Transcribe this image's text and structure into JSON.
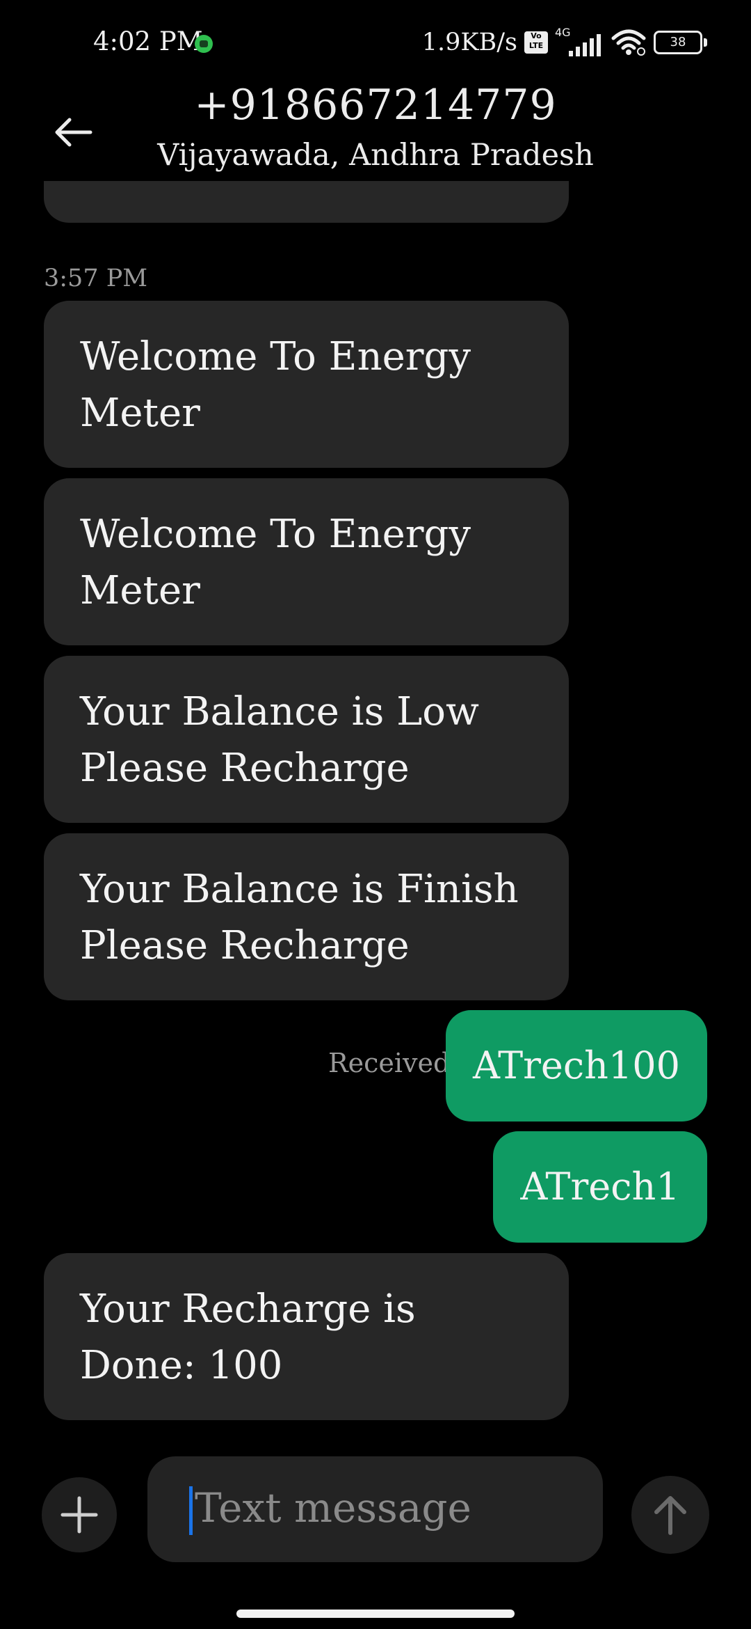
{
  "status_bar": {
    "time": "4:02 PM",
    "network_speed": "1.9KB/s",
    "volte_label": "Vo LTE",
    "network_type": "4G",
    "battery": "38",
    "icons": [
      "app-notification-icon",
      "volte-icon",
      "signal-icon",
      "wifi-icon",
      "battery-icon"
    ]
  },
  "header": {
    "back_icon": "arrow-left-icon",
    "title": "+918667214779",
    "subtitle": "Vijayawada, Andhra Pradesh"
  },
  "conversation": {
    "timestamp": "3:57 PM",
    "messages": [
      {
        "direction": "incoming",
        "text": "Welcome To Energy Meter"
      },
      {
        "direction": "incoming",
        "text": "Welcome To Energy Meter"
      },
      {
        "direction": "incoming",
        "text": "Your Balance is Low Please Recharge"
      },
      {
        "direction": "incoming",
        "text": "Your Balance is Finish Please Recharge"
      },
      {
        "direction": "outgoing",
        "text": "ATrech100",
        "status": "Received"
      },
      {
        "direction": "outgoing",
        "text": "ATrech1"
      },
      {
        "direction": "incoming",
        "text": "Your Recharge is Done: 100"
      }
    ]
  },
  "composer": {
    "placeholder": "Text message",
    "add_icon": "plus-icon",
    "send_icon": "arrow-up-icon"
  },
  "colors": {
    "background": "#000000",
    "incoming_bubble": "#272727",
    "outgoing_bubble": "#0f9b63",
    "caret": "#1a73e8"
  }
}
